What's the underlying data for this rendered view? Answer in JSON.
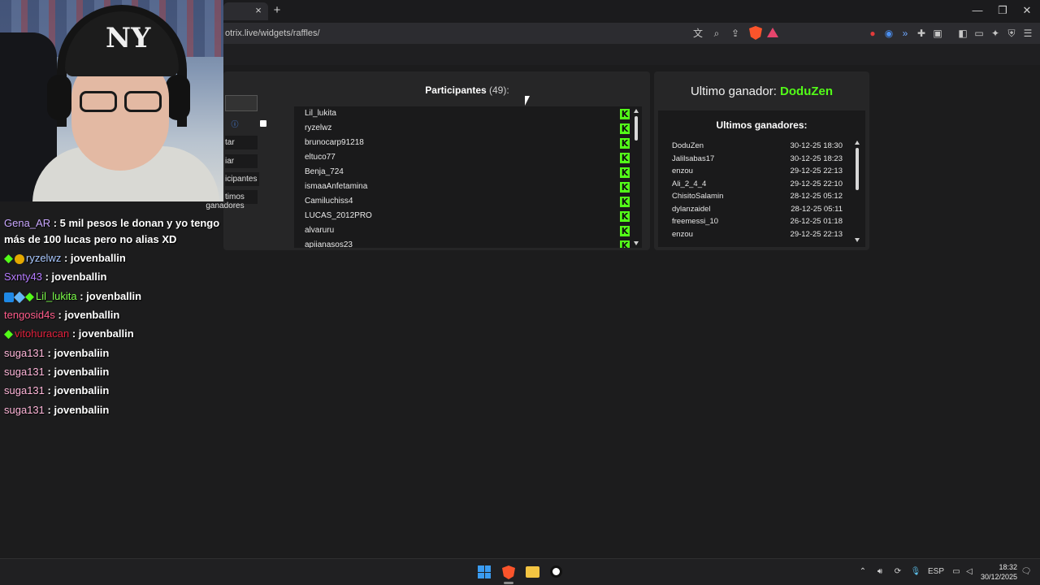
{
  "browser": {
    "tab_close": "×",
    "new_tab": "+",
    "url": "otrix.live/widgets/raffles/",
    "window_controls": {
      "minimize": "—",
      "maximize": "❐",
      "close": "✕"
    },
    "toolbar_icons": [
      "translate-icon",
      "zoom-icon",
      "share-icon",
      "brave-shield-icon",
      "brave-rewards-icon"
    ],
    "extension_icons": [
      "record-icon",
      "vpn-icon",
      "wallet-icon",
      "extensions-icon",
      "media-icon",
      "sidebar-icon",
      "wallet-panel-icon",
      "leo-ai-icon",
      "shield-icon",
      "menu-icon"
    ]
  },
  "controls": {
    "button_1": "tar",
    "button_2": "iar",
    "button_3": "icipantes",
    "button_4_line1": "timos",
    "button_4_line2": "ganadores"
  },
  "participants": {
    "title": "Participantes",
    "count": "(49):",
    "items": [
      "Lil_lukita",
      "ryzelwz",
      "brunocarp91218",
      "eltuco77",
      "Benja_724",
      "ismaaAnfetamina",
      "Camiluchiss4",
      "LUCAS_2012PRO",
      "alvaruru",
      "apiianasos23"
    ]
  },
  "winners": {
    "last_label": "Ultimo ganador:",
    "last_name": "DoduZen",
    "heading": "Ultimos ganadores:",
    "rows": [
      {
        "name": "DoduZen",
        "date": "30-12-25 18:30"
      },
      {
        "name": "Jalilsabas17",
        "date": "30-12-25 18:23"
      },
      {
        "name": "enzou",
        "date": "29-12-25 22:13"
      },
      {
        "name": "Ali_2_4_4",
        "date": "29-12-25 22:10"
      },
      {
        "name": "ChisitoSalamin",
        "date": "28-12-25 05:12"
      },
      {
        "name": "dylanzaidel",
        "date": "28-12-25 05:11"
      },
      {
        "name": "freemessi_10",
        "date": "26-12-25 01:18"
      },
      {
        "name": "enzou",
        "date": "29-12-25 22:13"
      }
    ]
  },
  "webcam": {
    "cap_logo": "NY"
  },
  "chat": [
    {
      "user": "Gena_AR",
      "color": "#c9a7ff",
      "message": ": 5 mil pesos le donan y yo tengo",
      "badges": []
    },
    {
      "user": "",
      "color": "#ffffff",
      "message": "más de 100 lucas pero no alias XD",
      "badges": []
    },
    {
      "user": "ryzelwz",
      "color": "#a9c8ff",
      "message": ": jovenballin",
      "badges": [
        "green",
        "gold"
      ]
    },
    {
      "user": "Sxnty43",
      "color": "#b57bff",
      "message": ": jovenballin",
      "badges": []
    },
    {
      "user": "Lil_lukita",
      "color": "#7cff4a",
      "message": ": jovenballin",
      "badges": [
        "blue",
        "cube",
        "green"
      ]
    },
    {
      "user": "tengosid4s",
      "color": "#ff5c8a",
      "message": ": jovenballin",
      "badges": []
    },
    {
      "user": "vitohuracan",
      "color": "#e0203c",
      "message": ": jovenballin",
      "badges": [
        "green"
      ]
    },
    {
      "user": "suga131",
      "color": "#ffb6d9",
      "message": ": jovenbaliin",
      "badges": []
    },
    {
      "user": "suga131",
      "color": "#ffb6d9",
      "message": ": jovenbaliin",
      "badges": []
    },
    {
      "user": "suga131",
      "color": "#ffb6d9",
      "message": ": jovenbaliin",
      "badges": []
    },
    {
      "user": "suga131",
      "color": "#ffb6d9",
      "message": ": jovenbaliin",
      "badges": []
    }
  ],
  "taskbar": {
    "apps": [
      "windows-start-icon",
      "brave-browser-icon",
      "file-explorer-icon",
      "obs-studio-icon"
    ],
    "lang": "ESP",
    "time": "18:32",
    "date": "30/12/2025"
  },
  "colors": {
    "kick_green": "#53fc18",
    "panel": "#262627",
    "list_bg": "#1a1a1b"
  }
}
